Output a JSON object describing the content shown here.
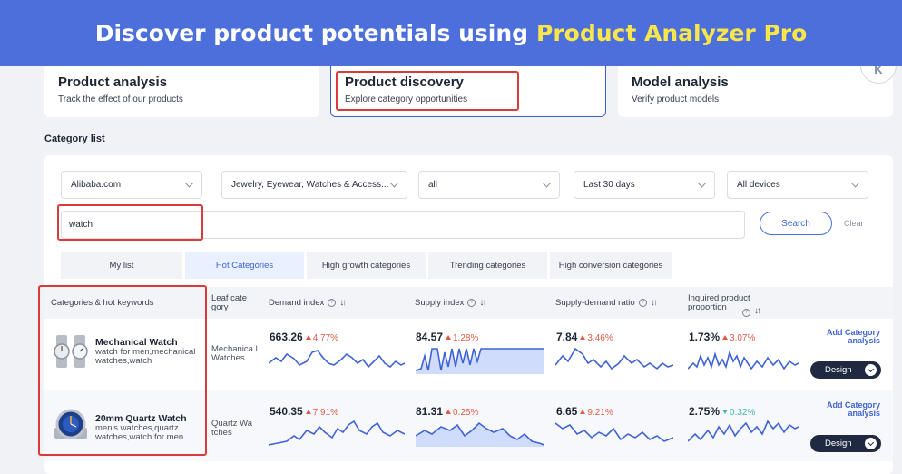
{
  "banner": {
    "prefix": "Discover product potentials using",
    "highlight": "Product Analyzer Pro"
  },
  "user_badge": "K",
  "cards": [
    {
      "title": "Product analysis",
      "subtitle": "Track the effect of our products"
    },
    {
      "title": "Product discovery",
      "subtitle": "Explore category opportunities"
    },
    {
      "title": "Model analysis",
      "subtitle": "Verify product models"
    }
  ],
  "category_list_title": "Category list",
  "filters": {
    "platform": "Alibaba.com",
    "category": "Jewelry, Eyewear, Watches & Access...",
    "sub": "all",
    "period": "Last 30 days",
    "devices": "All devices"
  },
  "search": {
    "value": "watch",
    "button": "Search",
    "clear": "Clear"
  },
  "tabs": [
    "My list",
    "Hot Categories",
    "High growth categories",
    "Trending categories",
    "High conversion categories"
  ],
  "headers": {
    "categories": "Categories & hot keywords",
    "leaf": "Leaf cate gory",
    "demand": "Demand index",
    "supply": "Supply index",
    "ratio": "Supply-demand ratio",
    "inquired": "Inquired product proportion"
  },
  "rows": [
    {
      "name": "Mechanical Watch",
      "keywords": "watch for men,mechanical watches,watch",
      "leaf": "Mechanica l Watches",
      "demand": {
        "value": "663.26",
        "change": "4.77%",
        "dir": "up"
      },
      "supply": {
        "value": "84.57",
        "change": "1.28%",
        "dir": "up"
      },
      "ratio": {
        "value": "7.84",
        "change": "3.46%",
        "dir": "up"
      },
      "inquired": {
        "value": "1.73%",
        "change": "3.07%",
        "dir": "up"
      },
      "add_link": "Add Category analysis",
      "design": "Design"
    },
    {
      "name": "20mm Quartz Watch",
      "keywords": "men's watches,quartz watches,watch for men",
      "leaf": "Quartz Wa tches",
      "demand": {
        "value": "540.35",
        "change": "7.91%",
        "dir": "up"
      },
      "supply": {
        "value": "81.31",
        "change": "0.25%",
        "dir": "up"
      },
      "ratio": {
        "value": "6.65",
        "change": "9.21%",
        "dir": "up"
      },
      "inquired": {
        "value": "2.75%",
        "change": "0.32%",
        "dir": "down"
      },
      "add_link": "Add Category analysis",
      "design": "Design"
    }
  ],
  "colors": {
    "banner": "#4d6fdb",
    "banner_highlight": "#f9e64a",
    "accent": "#3f63d6",
    "up": "#e05a4a",
    "down": "#3fb8b0",
    "annotation_red": "#d93a3a"
  }
}
